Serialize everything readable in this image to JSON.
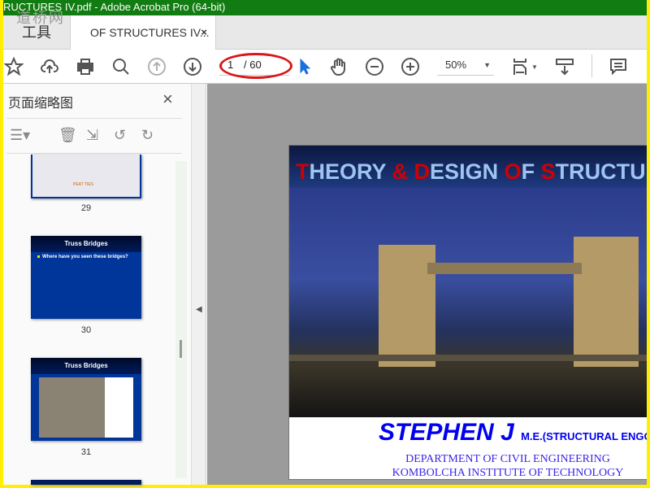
{
  "window": {
    "title": "RUCTURES IV.pdf - Adobe Acrobat Pro (64-bit)",
    "watermark": "道桥网"
  },
  "tabs": {
    "tools": "工具",
    "document": "OF STRUCTURES IV...",
    "close": "×"
  },
  "toolbar": {
    "page_current": "1",
    "page_total": "/ 60",
    "zoom": "50%"
  },
  "sidebar": {
    "title": "页面缩略图",
    "close": "×",
    "thumbnails": [
      {
        "page": "29",
        "caption": "PEAT TIES"
      },
      {
        "page": "30",
        "title": "Truss Bridges",
        "bullet": "Where have you seen these bridges?"
      },
      {
        "page": "31",
        "title": "Truss Bridges"
      }
    ]
  },
  "slide": {
    "title_parts": [
      "T",
      "HEORY ",
      "&",
      " ",
      "D",
      "ESIGN ",
      "O",
      "F ",
      "S",
      "TRUCTU"
    ],
    "author": "STEPHEN J",
    "degree": "M.E.(STRUCTURAL ENGG",
    "dept": "DEPARTMENT OF CIVIL ENGINEERING",
    "institute": "KOMBOLCHA INSTITUTE OF TECHNOLOGY"
  }
}
